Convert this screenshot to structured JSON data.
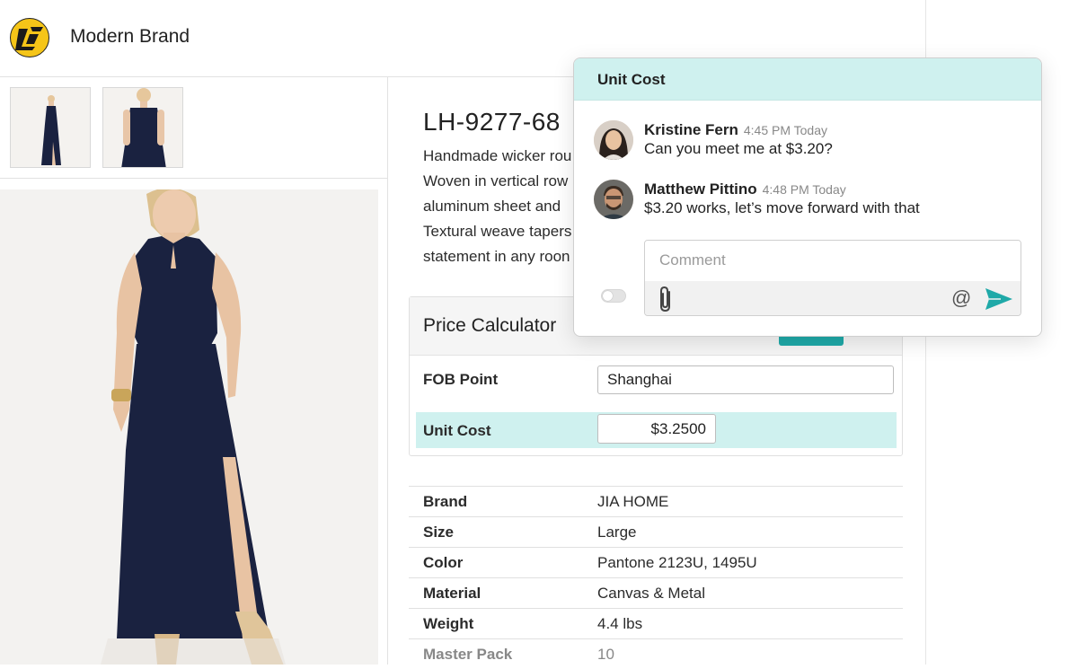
{
  "header": {
    "brand_name": "Modern Brand",
    "logo_icon": "brand-logo-icon"
  },
  "product": {
    "sku": "LH-9277-68",
    "description_lines": [
      "Handmade wicker rou",
      "Woven in vertical row",
      "aluminum sheet and",
      "Textural weave tapers",
      "statement in any roon"
    ]
  },
  "price_calculator": {
    "title": "Price Calculator",
    "fob_label": "FOB Point",
    "fob_value": "Shanghai",
    "unit_cost_label": "Unit Cost",
    "unit_cost_value": "$3.2500"
  },
  "specs": [
    {
      "key": "Brand",
      "value": "JIA HOME"
    },
    {
      "key": "Size",
      "value": "Large"
    },
    {
      "key": "Color",
      "value": "Pantone 2123U, 1495U"
    },
    {
      "key": "Material",
      "value": "Canvas & Metal"
    },
    {
      "key": "Weight",
      "value": "4.4 lbs"
    },
    {
      "key": "Master Pack",
      "value": "10"
    }
  ],
  "comment_popup": {
    "title": "Unit Cost",
    "messages": [
      {
        "name": "Kristine Fern",
        "time": "4:45 PM Today",
        "text": "Can you meet me at $3.20?"
      },
      {
        "name": "Matthew Pittino",
        "time": "4:48 PM Today",
        "text": "$3.20 works, let’s move forward with that"
      }
    ],
    "comment_placeholder": "Comment",
    "icons": [
      "paperclip-icon",
      "at-mention-icon",
      "send-icon"
    ]
  },
  "colors": {
    "accent_teal": "#1fa9a8",
    "highlight": "#cff1ef",
    "logo_yellow": "#f5c518",
    "dress_navy": "#1a2240"
  }
}
